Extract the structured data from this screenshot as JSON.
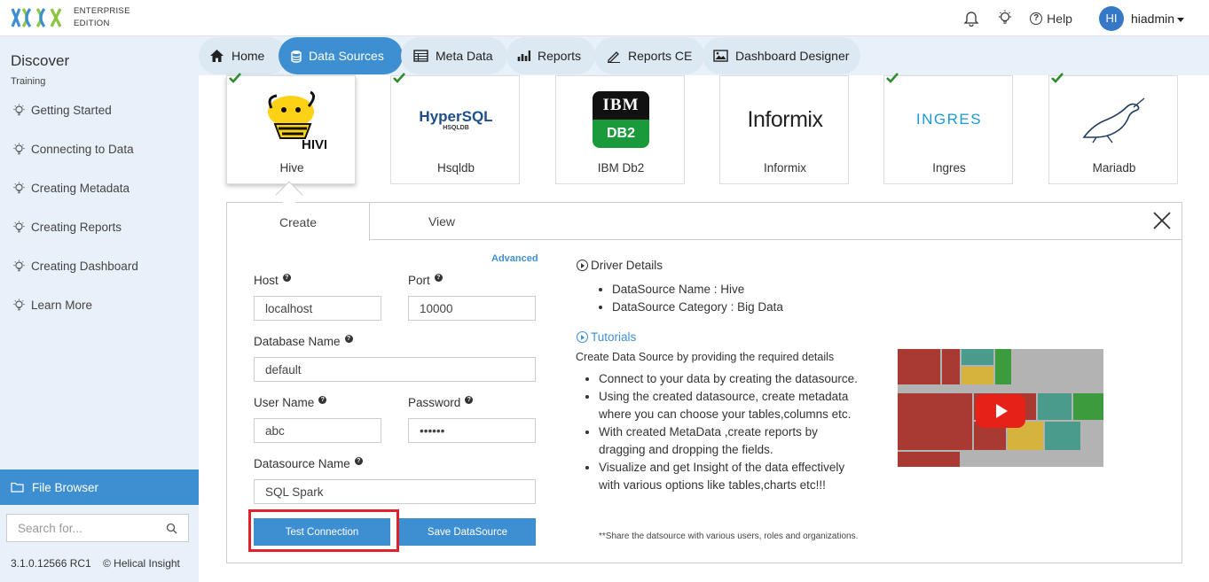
{
  "header": {
    "edition_line1": "ENTERPRISE",
    "edition_line2": "EDITION",
    "help_label": "Help",
    "avatar_initials": "HI",
    "username": "hiadmin"
  },
  "sidebar": {
    "title": "Discover",
    "subtitle": "Training",
    "items": [
      {
        "label": "Getting Started"
      },
      {
        "label": "Connecting to Data"
      },
      {
        "label": "Creating Metadata"
      },
      {
        "label": "Creating Reports"
      },
      {
        "label": "Creating Dashboard"
      },
      {
        "label": "Learn More"
      }
    ],
    "file_browser_label": "File Browser",
    "search_placeholder": "Search for...",
    "version": "3.1.0.12566 RC1",
    "copyright": "© Helical Insight"
  },
  "tabs": [
    {
      "label": "Home"
    },
    {
      "label": "Data Sources"
    },
    {
      "label": "Meta Data"
    },
    {
      "label": "Reports"
    },
    {
      "label": "Reports CE"
    },
    {
      "label": "Dashboard Designer"
    }
  ],
  "active_tab": "Data Sources",
  "datasources": [
    {
      "label": "Hive",
      "checked": true,
      "logo_text": "HIVE"
    },
    {
      "label": "Hsqldb",
      "checked": true,
      "logo_text": "HyperSQL",
      "logo_sub": "HSQLDB"
    },
    {
      "label": "IBM Db2",
      "checked": false,
      "logo_text": "IBM",
      "logo_sub": "DB2"
    },
    {
      "label": "Informix",
      "checked": false,
      "logo_text": "Informix"
    },
    {
      "label": "Ingres",
      "checked": true,
      "logo_text": "INGRES"
    },
    {
      "label": "Mariadb",
      "checked": true
    }
  ],
  "panel": {
    "tab_create": "Create",
    "tab_view": "View",
    "advanced": "Advanced",
    "host_label": "Host",
    "host_value": "localhost",
    "port_label": "Port",
    "port_value": "10000",
    "database_label": "Database Name",
    "database_value": "default",
    "user_label": "User Name",
    "user_value": "abc",
    "password_label": "Password",
    "password_value": "abcdef",
    "datasource_name_label": "Datasource Name",
    "datasource_name_value": "SQL Spark",
    "test_button": "Test Connection",
    "save_button": "Save DataSource"
  },
  "info": {
    "driver_title": "Driver Details",
    "driver_items": [
      "DataSource Name : Hive",
      "DataSource Category : Big Data"
    ],
    "tutorials_title": "Tutorials",
    "tutorials_intro": "Create Data Source by providing the required details",
    "tutorial_items": [
      "Connect to your data by creating the datasource.",
      "Using the created datasource, create metadata where you can choose your tables,columns etc.",
      "With created MetaData ,create reports by dragging and dropping the fields.",
      "Visualize and get Insight of the data effectively with various options like tables,charts etc!!!"
    ],
    "note": "**Share the datsource with various users, roles and organizations."
  },
  "colors": {
    "accent": "#3e8fd2",
    "highlight": "#e0202a",
    "check": "#2e8b2e"
  }
}
